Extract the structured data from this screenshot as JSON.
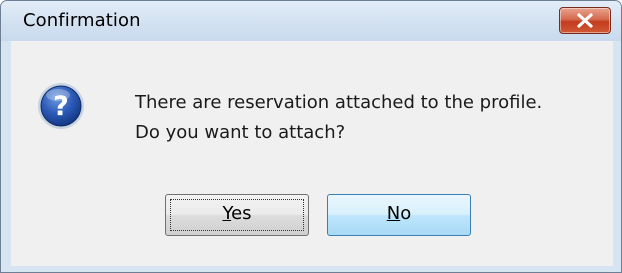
{
  "window": {
    "title": "Confirmation"
  },
  "dialog": {
    "icon": "question-icon",
    "message_line1": "There are reservation attached to the profile.",
    "message_line2": "Do you want to attach?"
  },
  "buttons": {
    "yes": {
      "mnemonic": "Y",
      "rest": "es"
    },
    "no": {
      "mnemonic": "N",
      "rest": "o"
    }
  },
  "colors": {
    "close_button": "#c43c1f",
    "titlebar": "#d5e3f2",
    "dialog_background": "#f0f0f0",
    "no_button_hover": "#bee6fd"
  }
}
